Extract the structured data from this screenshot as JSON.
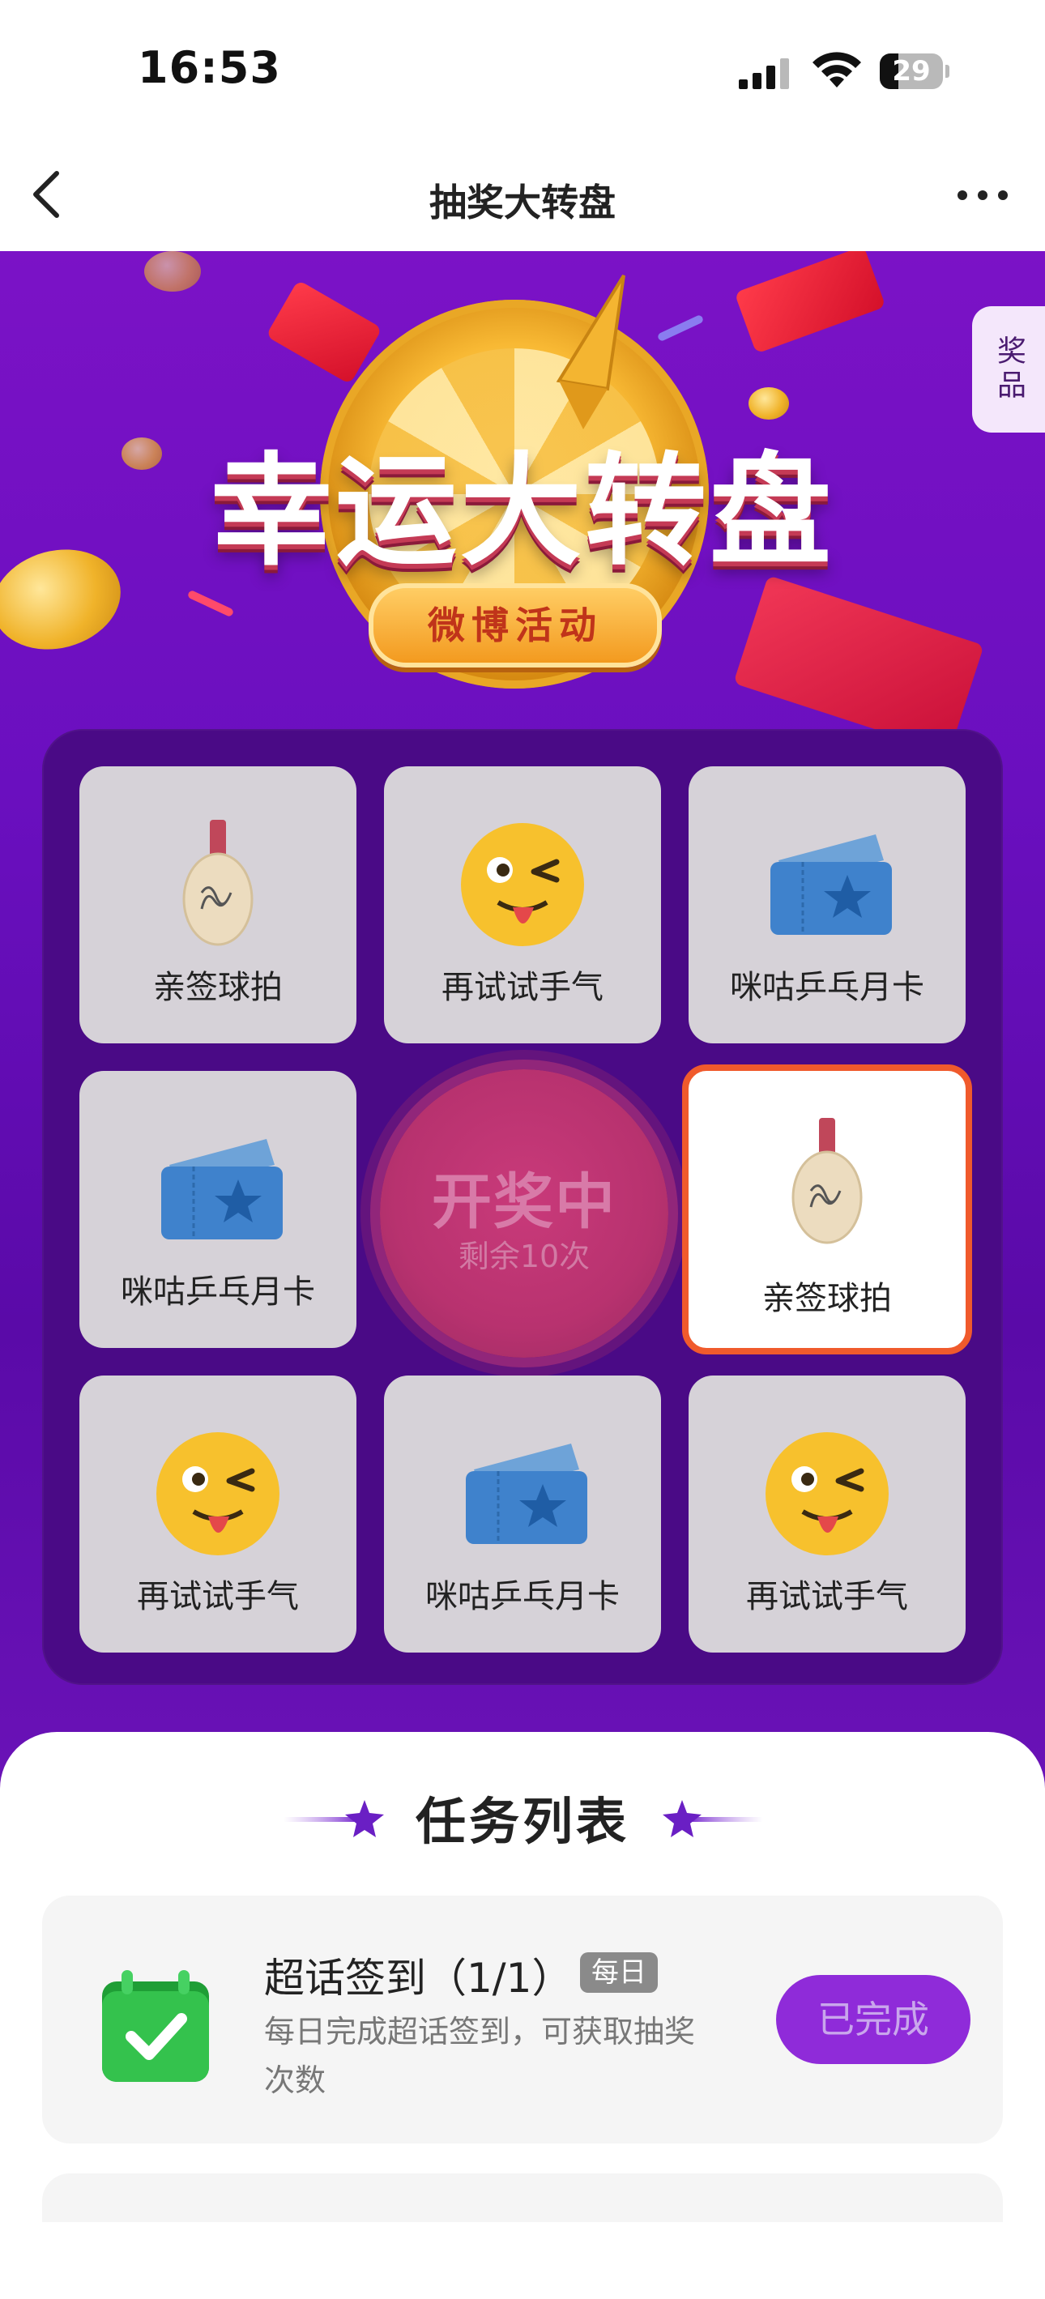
{
  "status_bar": {
    "time": "16:53",
    "battery": "29",
    "battery_level": 0.29
  },
  "nav": {
    "title": "抽奖大转盘"
  },
  "prize_tab": {
    "label": "奖品"
  },
  "banner": {
    "title": "幸运大转盘",
    "subtitle": "微博活动"
  },
  "grid": {
    "cells": [
      {
        "label": "亲签球拍",
        "icon": "paddle-icon",
        "active": false
      },
      {
        "label": "再试试手气",
        "icon": "wink-emoji-icon",
        "active": false
      },
      {
        "label": "咪咕乒乓月卡",
        "icon": "ticket-icon",
        "active": false
      },
      {
        "label": "咪咕乒乓月卡",
        "icon": "ticket-icon",
        "active": false
      },
      {
        "label": "亲签球拍",
        "icon": "paddle-icon",
        "active": true
      },
      {
        "label": "再试试手气",
        "icon": "wink-emoji-icon",
        "active": false
      },
      {
        "label": "咪咕乒乓月卡",
        "icon": "ticket-icon",
        "active": false
      },
      {
        "label": "再试试手气",
        "icon": "wink-emoji-icon",
        "active": false
      }
    ],
    "draw_button": {
      "title": "开奖中",
      "remaining": "剩余10次"
    }
  },
  "tasks": {
    "title": "任务列表",
    "items": [
      {
        "name": "超话签到（1/1）",
        "badge": "每日",
        "description": "每日完成超话签到，可获取抽奖次数",
        "button": "已完成",
        "icon": "calendar-check-icon"
      }
    ]
  },
  "colors": {
    "accent": "#8f2bd9",
    "active_border": "#f05a2c",
    "panel": "#4a0a86"
  }
}
